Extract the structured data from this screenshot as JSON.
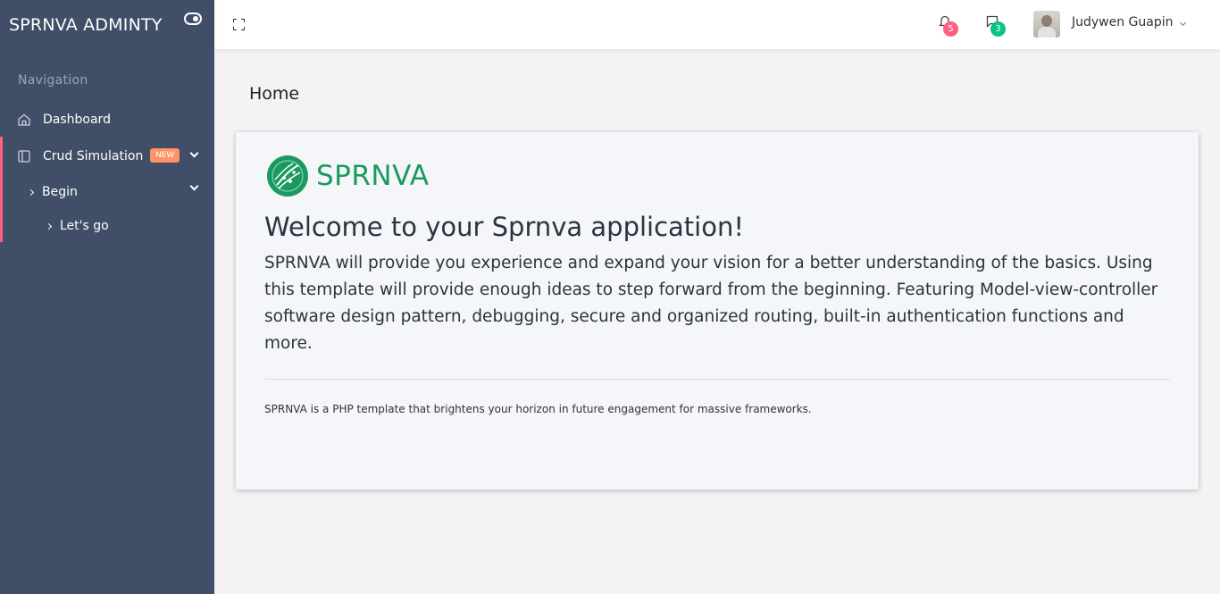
{
  "brand": {
    "title": "SPRNVA ADMINTY"
  },
  "sidebar": {
    "section_title": "Navigation",
    "items": [
      {
        "label": "Dashboard",
        "icon": "home-icon"
      },
      {
        "label": "Crud Simulation",
        "icon": "sidebar-icon",
        "badge": "NEW"
      },
      {
        "label": "Begin"
      },
      {
        "label": "Let's go"
      }
    ]
  },
  "header": {
    "notifications_count": "5",
    "messages_count": "3",
    "user_name": "Judywen Guapin"
  },
  "main": {
    "page_title": "Home",
    "logo_text": "SPRNVA",
    "welcome_title": "Welcome to your Sprnva application!",
    "lead": "SPRNVA will provide you experience and expand your vision for a better understanding of the basics. Using this template will provide enough ideas to step forward from the beginning. Featuring Model-view-controller software design pattern, debugging, secure and organized routing, built-in authentication functions and more.",
    "footnote": "SPRNVA is a PHP template that brightens your horizon in future engagement for massive frameworks."
  },
  "colors": {
    "sidebar_bg": "#404e67",
    "accent_pink": "#fc6180",
    "badge_orange": "#fe9365",
    "badge_green": "#0ac282",
    "logo_green": "#1a9a5f"
  }
}
